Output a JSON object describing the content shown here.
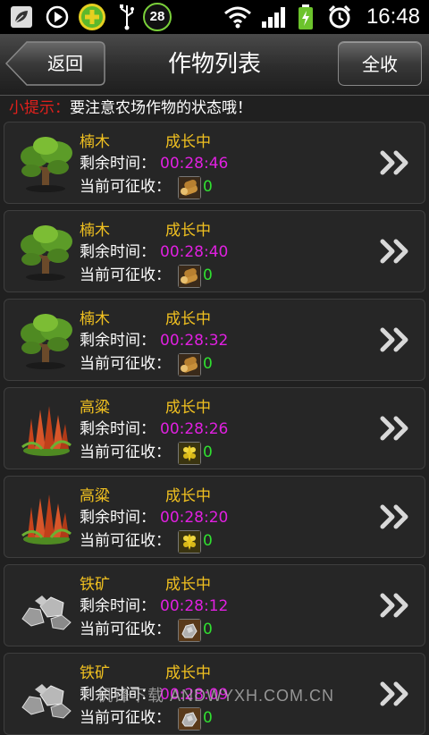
{
  "status_bar": {
    "time": "16:48",
    "notification_count": "28",
    "icons": [
      "leaf-icon",
      "play-icon",
      "plus-security-icon",
      "usb-icon",
      "notification-count-icon",
      "wifi-icon",
      "signal-icon",
      "battery-icon",
      "alarm-icon"
    ]
  },
  "header": {
    "title": "作物列表",
    "back_label": "返回",
    "collect_all_label": "全收"
  },
  "tip": {
    "label": "小提示：",
    "text": "要注意农场作物的状态哦！"
  },
  "row_labels": {
    "remaining": "剩余时间：",
    "yield": "当前可征收："
  },
  "crops": [
    {
      "name": "楠木",
      "state": "成长中",
      "remaining": "00:28:46",
      "yield": "0",
      "icon": "tree-icon",
      "resource": "wood-icon"
    },
    {
      "name": "楠木",
      "state": "成长中",
      "remaining": "00:28:40",
      "yield": "0",
      "icon": "tree-icon",
      "resource": "wood-icon"
    },
    {
      "name": "楠木",
      "state": "成长中",
      "remaining": "00:28:32",
      "yield": "0",
      "icon": "tree-icon",
      "resource": "wood-icon"
    },
    {
      "name": "高粱",
      "state": "成长中",
      "remaining": "00:28:26",
      "yield": "0",
      "icon": "sorghum-icon",
      "resource": "grain-icon"
    },
    {
      "name": "高粱",
      "state": "成长中",
      "remaining": "00:28:20",
      "yield": "0",
      "icon": "sorghum-icon",
      "resource": "grain-icon"
    },
    {
      "name": "铁矿",
      "state": "成长中",
      "remaining": "00:28:12",
      "yield": "0",
      "icon": "iron-ore-icon",
      "resource": "ore-icon"
    },
    {
      "name": "铁矿",
      "state": "成长中",
      "remaining": "00:28:09",
      "yield": "0",
      "icon": "iron-ore-icon",
      "resource": "ore-icon"
    }
  ],
  "watermark": "机锋下载 ANDWYXH.COM.CN",
  "colors": {
    "name": "#f0c020",
    "timer": "#e020e0",
    "yield": "#30e030",
    "tip_label": "#e0201c"
  }
}
